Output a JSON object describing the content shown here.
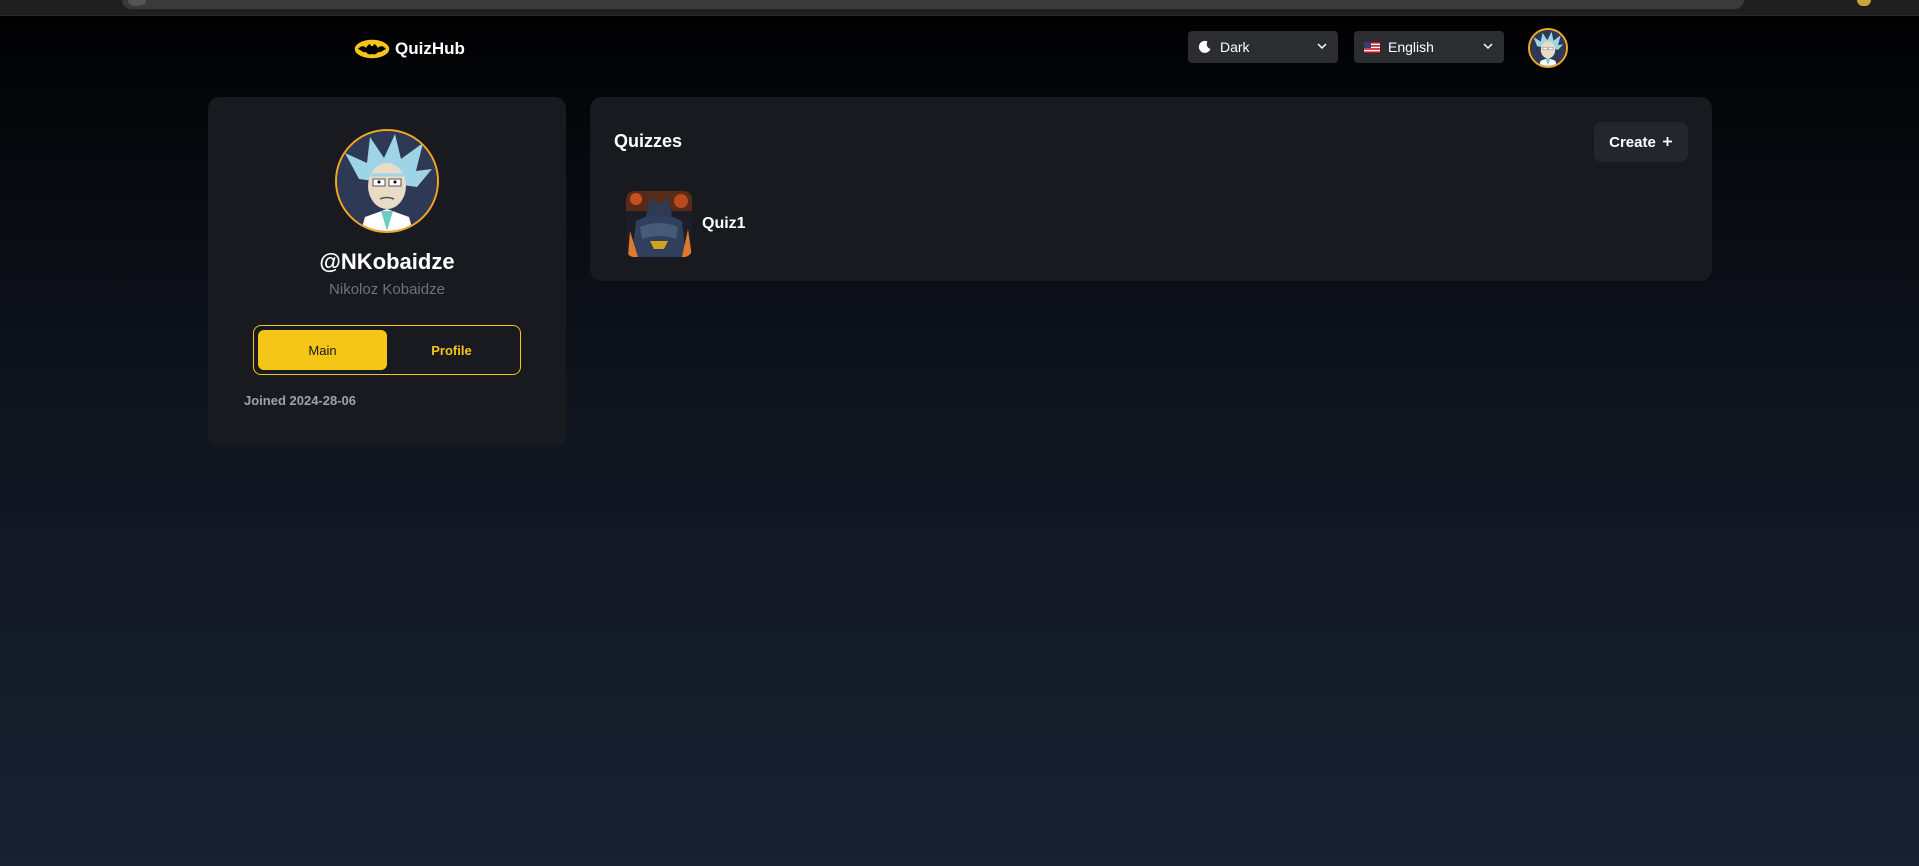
{
  "header": {
    "app_name": "QuizHub",
    "theme_select": {
      "value": "Dark",
      "icon": "moon-icon"
    },
    "language_select": {
      "value": "English",
      "icon": "us-flag-icon"
    }
  },
  "profile": {
    "username": "@NKobaidze",
    "full_name": "Nikoloz Kobaidze",
    "tabs": [
      {
        "label": "Main",
        "active": true
      },
      {
        "label": "Profile",
        "active": false
      }
    ],
    "joined": "Joined 2024-28-06"
  },
  "quizzes": {
    "heading": "Quizzes",
    "create_label": "Create",
    "create_icon": "plus-icon",
    "items": [
      {
        "name": "Quiz1"
      }
    ]
  },
  "colors": {
    "accent": "#f5c518",
    "avatar_border": "#f5a623",
    "card_bg": "#181a20"
  }
}
